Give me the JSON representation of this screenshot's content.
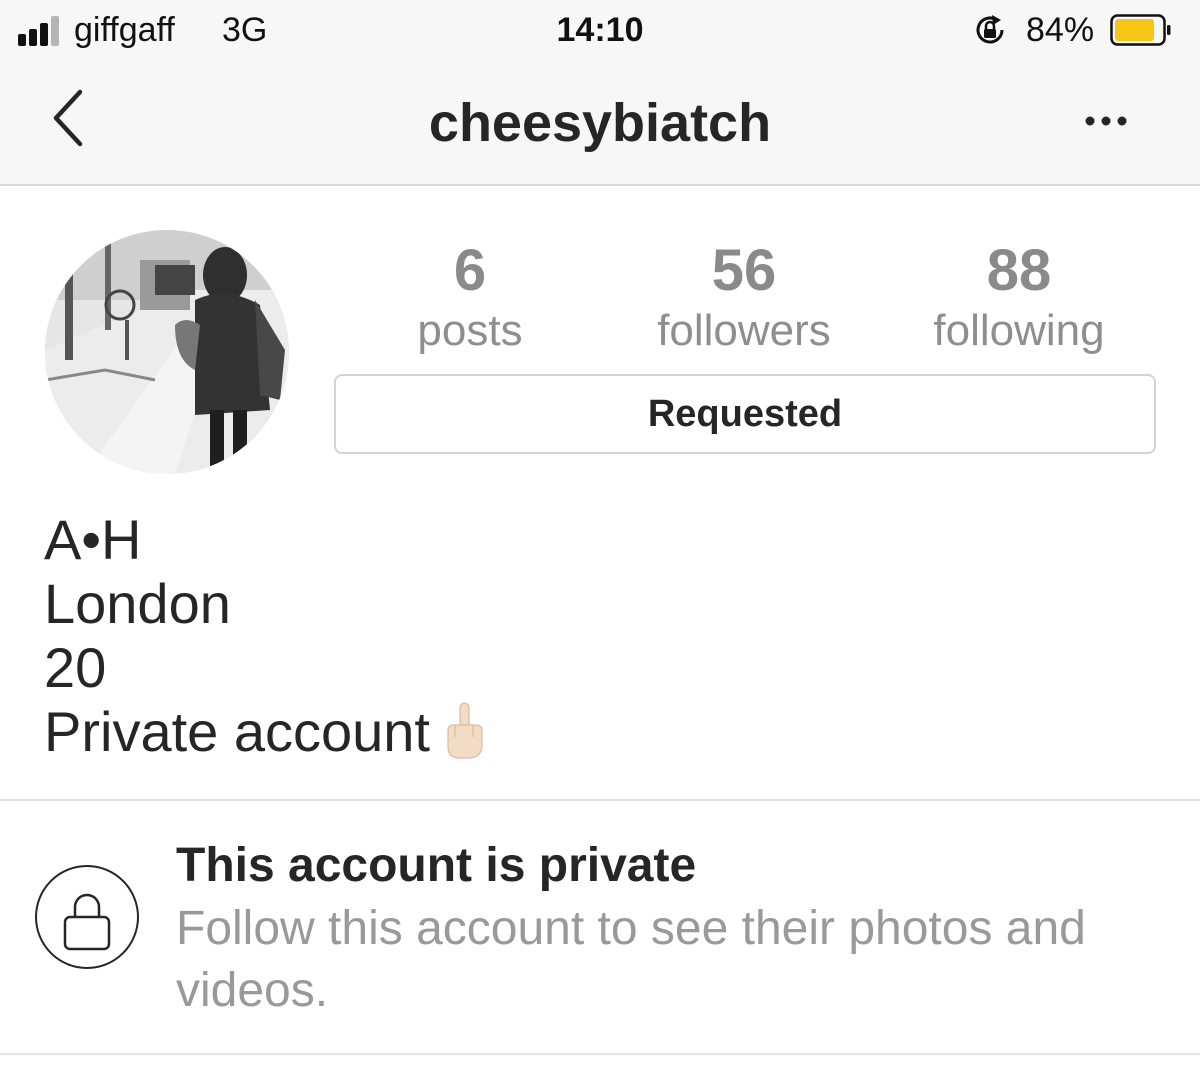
{
  "status_bar": {
    "carrier": "giffgaff",
    "network": "3G",
    "time": "14:10",
    "battery_percent": "84%",
    "signal_bars_filled": 3,
    "signal_bars_total": 4,
    "battery_level": 0.84,
    "battery_color": "#f5c518",
    "icons": [
      "signal-icon",
      "rotation-lock-icon",
      "battery-icon"
    ]
  },
  "nav": {
    "username": "cheesybiatch",
    "back_icon": "chevron-left-icon",
    "more_icon": "more-dots-icon"
  },
  "profile": {
    "stats": [
      {
        "value": "6",
        "label": "posts"
      },
      {
        "value": "56",
        "label": "followers"
      },
      {
        "value": "88",
        "label": "following"
      }
    ],
    "follow_button_label": "Requested"
  },
  "bio": {
    "name": "A•H",
    "location": "London",
    "age": "20",
    "note": "Private account",
    "note_emoji": "middle-finger-emoji"
  },
  "private_notice": {
    "title": "This account is private",
    "description": "Follow this account to see their photos and videos.",
    "icon": "lock-icon"
  }
}
